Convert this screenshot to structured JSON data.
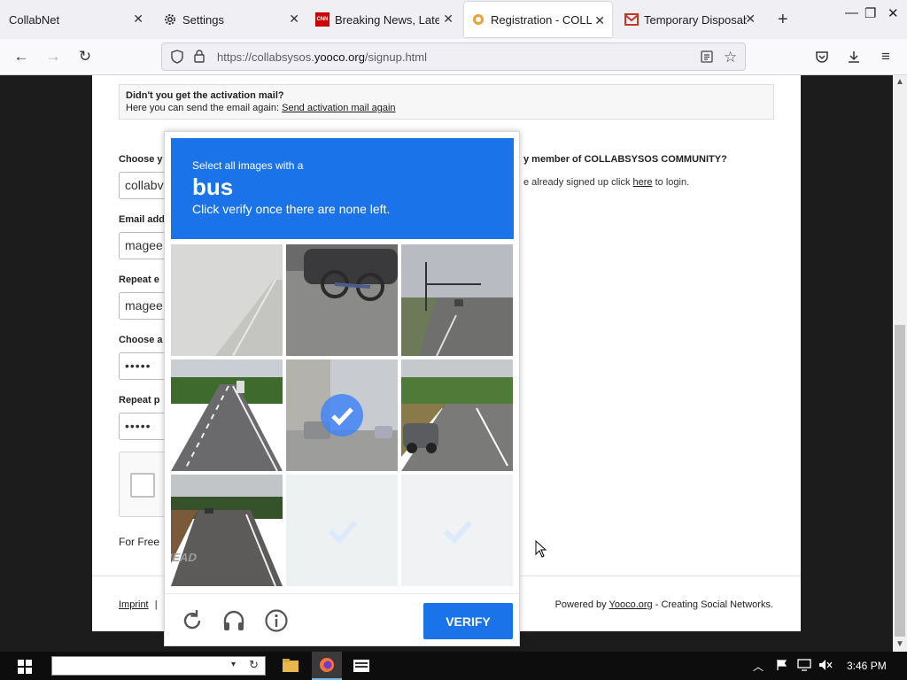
{
  "browser": {
    "tabs": [
      {
        "title": "CollabNet"
      },
      {
        "title": "Settings"
      },
      {
        "title": "Breaking News, Latest"
      },
      {
        "title": "Registration - COLLAB"
      },
      {
        "title": "Temporary Disposable"
      }
    ],
    "url_prefix": "https://collabsysos.",
    "url_domain": "yooco.org",
    "url_path": "/signup.html"
  },
  "page": {
    "activation_title": "Didn't you get the activation mail?",
    "activation_text": "Here you can send the email again: ",
    "activation_link": "Send activation mail again",
    "labels": {
      "choose_username": "Choose y",
      "email": "Email add",
      "repeat_email": "Repeat e",
      "choose_password": "Choose a",
      "repeat_password": "Repeat p"
    },
    "values": {
      "username": "collabv",
      "email": "magee",
      "repeat_email": "magee",
      "password": "•••••",
      "repeat_password": "•••••"
    },
    "for_free": "For Free",
    "right_title": "y member of COLLABSYSOS COMMUNITY?",
    "right_text_pre": "e already signed up click ",
    "right_link": "here",
    "right_text_post": " to login.",
    "footer_imprint": "Imprint",
    "footer_sep": "|",
    "footer_powered_pre": "Powered by ",
    "footer_powered_link": "Yooco.org",
    "footer_powered_post": " - Creating Social Networks."
  },
  "captcha": {
    "prompt": "Select all images with a",
    "word": "bus",
    "hint": "Click verify once there are none left.",
    "verify_label": "VERIFY",
    "tiles": [
      {
        "scene": "foggy-highway",
        "selected": false,
        "loading": false
      },
      {
        "scene": "car-with-bike-rack",
        "selected": false,
        "loading": false
      },
      {
        "scene": "road-with-traffic-lights",
        "selected": false,
        "loading": false
      },
      {
        "scene": "highway-with-truck",
        "selected": false,
        "loading": false
      },
      {
        "scene": "street-with-building",
        "selected": true,
        "loading": false
      },
      {
        "scene": "road-with-suv",
        "selected": false,
        "loading": false
      },
      {
        "scene": "road-marked-ahead",
        "selected": false,
        "loading": false
      },
      {
        "scene": "loading",
        "selected": true,
        "loading": true
      },
      {
        "scene": "loading",
        "selected": true,
        "loading": true
      }
    ],
    "ahead_text": "AHEAD"
  },
  "taskbar": {
    "time": "3:46 PM"
  },
  "colors": {
    "captcha_blue": "#1a73e8",
    "page_background": "#1c1c1c"
  }
}
